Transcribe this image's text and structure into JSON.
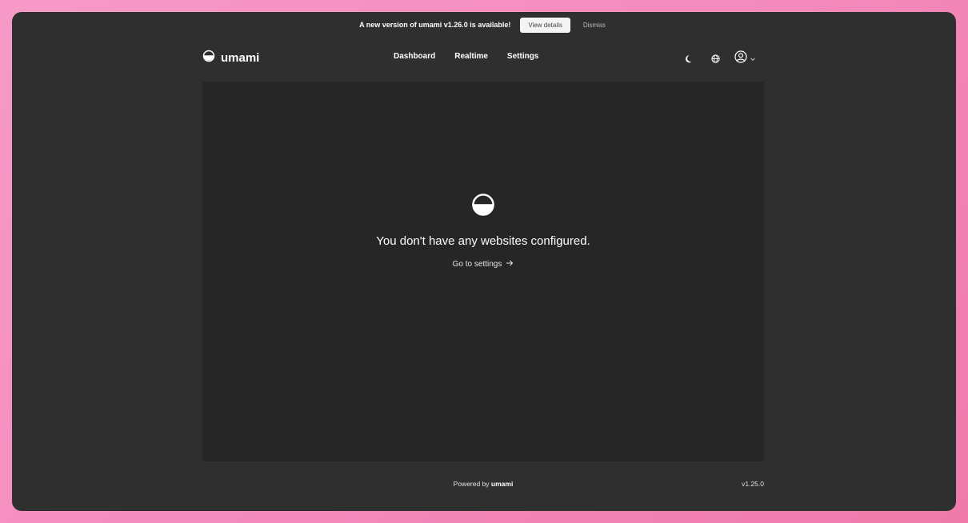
{
  "banner": {
    "message": "A new version of umami v1.26.0 is available!",
    "view_details_label": "View details",
    "dismiss_label": "Dismiss"
  },
  "header": {
    "brand": "umami",
    "nav": [
      {
        "label": "Dashboard"
      },
      {
        "label": "Realtime"
      },
      {
        "label": "Settings"
      }
    ],
    "icons": [
      "moon-icon",
      "globe-icon",
      "user-icon",
      "chevron-down-icon"
    ]
  },
  "main": {
    "empty_title": "You don't have any websites configured.",
    "settings_link": "Go to settings"
  },
  "footer": {
    "powered_by": "Powered by",
    "brand": "umami",
    "version": "v1.25.0"
  },
  "colors": {
    "window_bg": "#2f2f2f",
    "panel_bg": "#262626",
    "outer_bg": "#f48bbd",
    "text": "#ffffff"
  }
}
